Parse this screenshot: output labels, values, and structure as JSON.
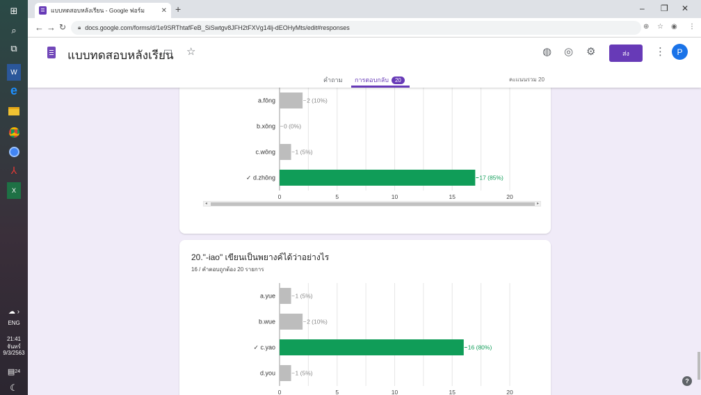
{
  "taskbar": {
    "language": "ENG",
    "time": "21:41",
    "day": "จันทร์",
    "date": "9/3/2563",
    "notification_count": "24"
  },
  "browser": {
    "tab_title": "แบบทดสอบหลังเรียน - Google ฟอร์ม",
    "url": "docs.google.com/forms/d/1e9SRThtafFeB_SiSwtgv8JFH2tFXVg14lj-dEOHyMts/edit#responses"
  },
  "form": {
    "title": "แบบทดสอบหลังเรียน",
    "send_label": "ส่ง",
    "avatar_initial": "P",
    "tabs": {
      "questions": "คำถาม",
      "responses": "การตอบกลับ",
      "responses_count": "20",
      "total_points": "คะแนนรวม 20"
    }
  },
  "question2": {
    "title": "20.\"-iao\" เขียนเป็นพยางค์ได้ว่าอย่างไร",
    "subtitle": "16 / คำตอบถูกต้อง 20 รายการ"
  },
  "chart_data": [
    {
      "type": "bar",
      "orientation": "horizontal",
      "categories": [
        "a.fōng",
        "b.xōng",
        "c.wōng",
        "✓ d.zhōng"
      ],
      "values": [
        2,
        0,
        1,
        17
      ],
      "value_labels": [
        "2 (10%)",
        "0 (0%)",
        "1 (5%)",
        "17 (85%)"
      ],
      "correct_index": 3,
      "xlim": [
        0,
        20
      ],
      "xticks": [
        "0",
        "5",
        "10",
        "15",
        "20"
      ],
      "grid": true,
      "colors": {
        "default": "#bdbdbd",
        "correct": "#109d58"
      }
    },
    {
      "type": "bar",
      "orientation": "horizontal",
      "categories": [
        "a.yue",
        "b.wue",
        "✓ c.yao",
        "d.you"
      ],
      "values": [
        1,
        2,
        16,
        1
      ],
      "value_labels": [
        "1 (5%)",
        "2 (10%)",
        "16 (80%)",
        "1 (5%)"
      ],
      "correct_index": 2,
      "xlim": [
        0,
        20
      ],
      "xticks": [
        "0",
        "5",
        "10",
        "15",
        "20"
      ],
      "grid": true,
      "colors": {
        "default": "#bdbdbd",
        "correct": "#109d58"
      }
    }
  ]
}
